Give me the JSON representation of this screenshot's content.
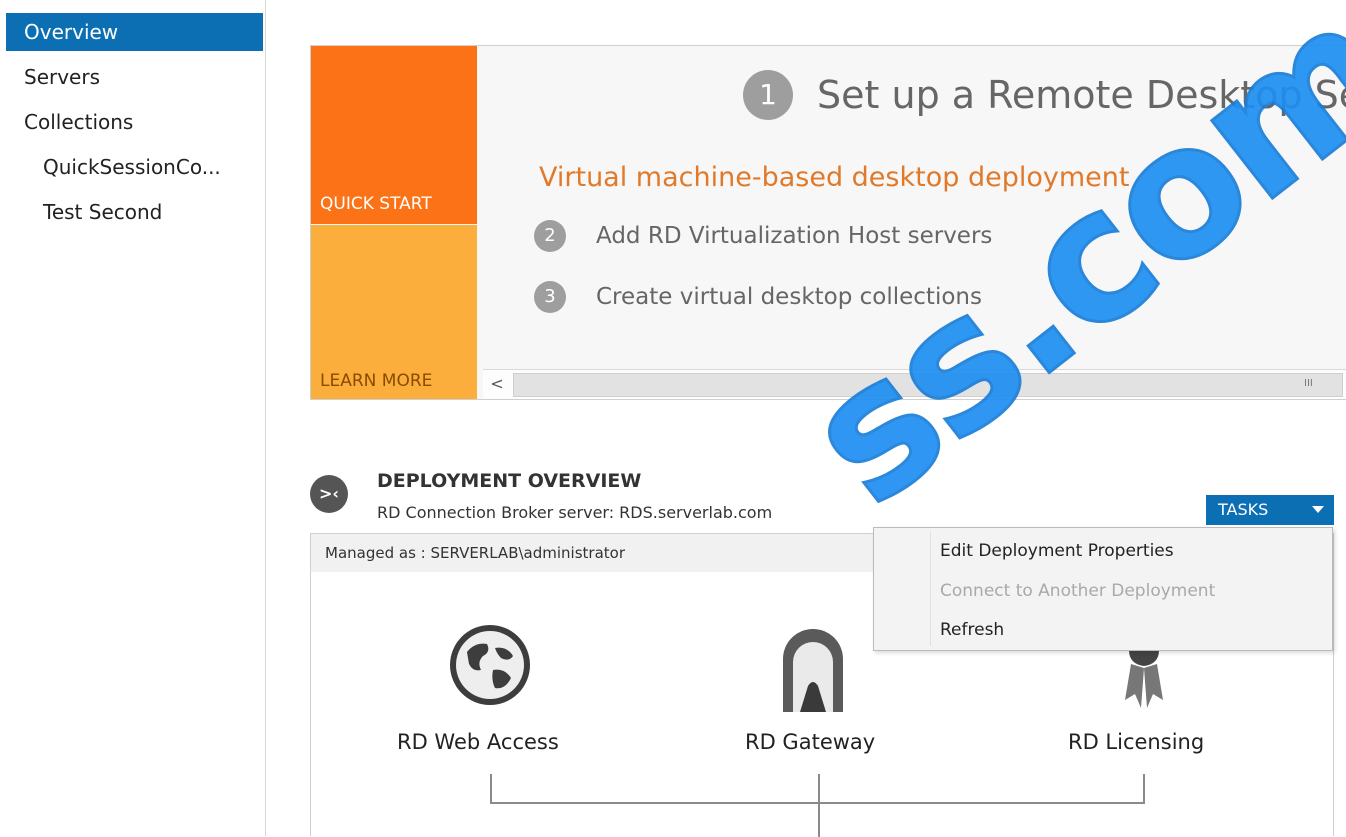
{
  "sidebar": {
    "items": [
      {
        "label": "Overview"
      },
      {
        "label": "Servers"
      },
      {
        "label": "Collections"
      },
      {
        "label": "QuickSessionCo..."
      },
      {
        "label": "Test Second"
      }
    ]
  },
  "quickstart": {
    "tile_quick_start": "QUICK START",
    "tile_learn_more": "LEARN MORE",
    "step1_number": "1",
    "step1_text": "Set up a Remote Desktop Se",
    "subtitle": "Virtual machine-based desktop deployment",
    "step2_number": "2",
    "step2_text": "Add RD Virtualization Host servers",
    "step3_number": "3",
    "step3_text": "Create virtual desktop collections",
    "scroll_left": "<",
    "scroll_grip": "III"
  },
  "deployment": {
    "title": "DEPLOYMENT OVERVIEW",
    "subtitle": "RD Connection Broker server: RDS.serverlab.com",
    "icon_glyph": ">‹",
    "managed_as": "Managed as : SERVERLAB\\administrator",
    "tasks_label": "TASKS",
    "roles": [
      {
        "label": "RD Web Access"
      },
      {
        "label": "RD Gateway"
      },
      {
        "label": "RD Licensing"
      }
    ]
  },
  "tasks_menu": {
    "items": [
      {
        "label": "Edit Deployment Properties",
        "enabled": true
      },
      {
        "label": "Connect to Another Deployment",
        "enabled": false
      },
      {
        "label": "Refresh",
        "enabled": true
      }
    ]
  },
  "watermark": "ss.com",
  "colors": {
    "accent_blue": "#0c6fb4",
    "quick_start_orange": "#fb7316",
    "learn_more_orange": "#fbae3c",
    "subtitle_orange": "#e07a2a"
  }
}
